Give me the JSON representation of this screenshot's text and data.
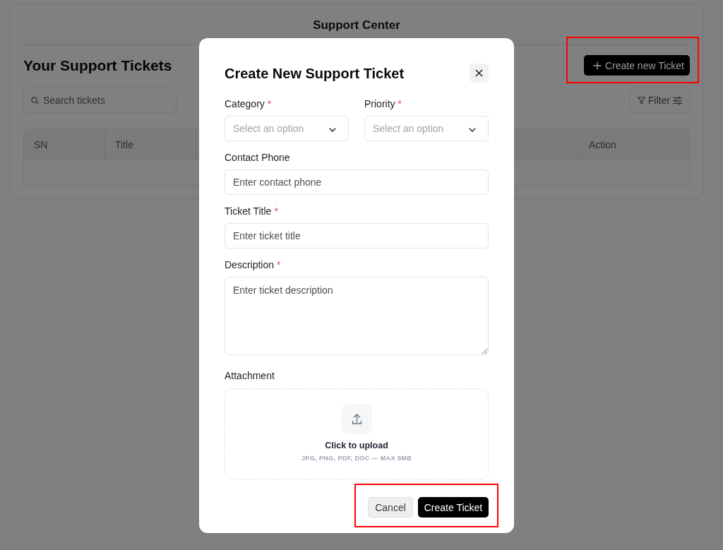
{
  "page": {
    "title": "Support Center",
    "heading": "Your Support Tickets",
    "create_button": {
      "label": "Create new Ticket",
      "highlighted": true
    },
    "search": {
      "placeholder": "Search tickets"
    },
    "filter_button": {
      "label": "Filter"
    },
    "table": {
      "columns": [
        {
          "label": "SN"
        },
        {
          "label": "Title"
        },
        {
          "label": "Action"
        }
      ]
    }
  },
  "modal": {
    "title": "Create New Support Ticket",
    "rows": [
      {
        "fields": [
          {
            "kind": "select",
            "label": "Category",
            "required_mark": "*",
            "placeholder": "Select an option"
          },
          {
            "kind": "select",
            "label": "Priority",
            "required_mark": "*",
            "placeholder": "Select an option"
          }
        ]
      },
      {
        "fields": [
          {
            "kind": "input",
            "label": "Contact Phone",
            "placeholder": "Enter contact phone"
          }
        ]
      },
      {
        "fields": [
          {
            "kind": "input",
            "label": "Ticket Title",
            "required_mark": "*",
            "placeholder": "Enter ticket title"
          }
        ]
      },
      {
        "fields": [
          {
            "kind": "textarea",
            "label": "Description",
            "required_mark": "*",
            "placeholder": "Enter ticket description"
          }
        ]
      }
    ],
    "attachment": {
      "label": "Attachment",
      "title": "Click to upload",
      "hint": "JPG, PNG, PDF, DOC — MAX 5MB"
    },
    "footer": {
      "highlighted": true,
      "buttons": [
        {
          "kind": "secondary",
          "label": "Cancel"
        },
        {
          "kind": "primary",
          "label": "Create Ticket"
        }
      ]
    }
  }
}
